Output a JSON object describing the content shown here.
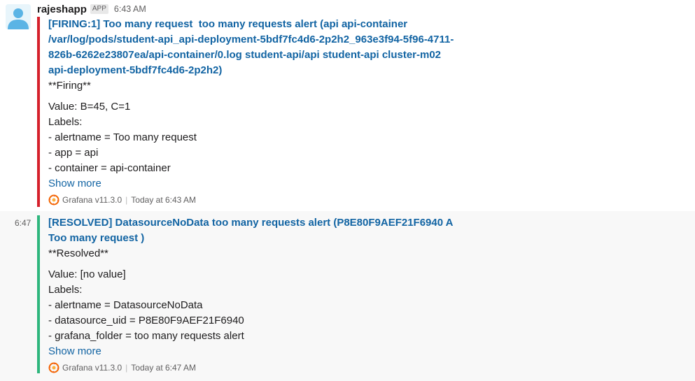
{
  "message1": {
    "username": "rajeshapp",
    "badge": "APP",
    "time": "6:43 AM",
    "title": "[FIRING:1] Too many request  too many requests alert (api api-container /var/log/pods/student-api_api-deployment-5bdf7fc4d6-2p2h2_963e3f94-5f96-4711-826b-6262e23807ea/api-container/0.log student-api/api student-api cluster-m02 api-deployment-5bdf7fc4d6-2p2h2)",
    "status_line": "**Firing**",
    "value_line": "Value: B=45, C=1",
    "labels_heading": "Labels:",
    "labels": [
      "- alertname = Too many request",
      "- app = api",
      "- container = api-container"
    ],
    "show_more": "Show more",
    "footer_source": "Grafana v11.3.0",
    "footer_time": "Today at 6:43 AM",
    "accent_color": "#d5202b"
  },
  "message2": {
    "hover_time": "6:47",
    "title": "[RESOLVED] DatasourceNoData too many requests alert (P8E80F9AEF21F6940 A Too many request )",
    "status_line": "**Resolved**",
    "value_line": "Value: [no value]",
    "labels_heading": "Labels:",
    "labels": [
      "- alertname = DatasourceNoData",
      "- datasource_uid = P8E80F9AEF21F6940",
      "- grafana_folder = too many requests alert"
    ],
    "show_more": "Show more",
    "footer_source": "Grafana v11.3.0",
    "footer_time": "Today at 6:47 AM",
    "accent_color": "#2eb67d"
  },
  "icons": {
    "avatar": "user-avatar-icon",
    "footer": "grafana-logo-icon"
  }
}
